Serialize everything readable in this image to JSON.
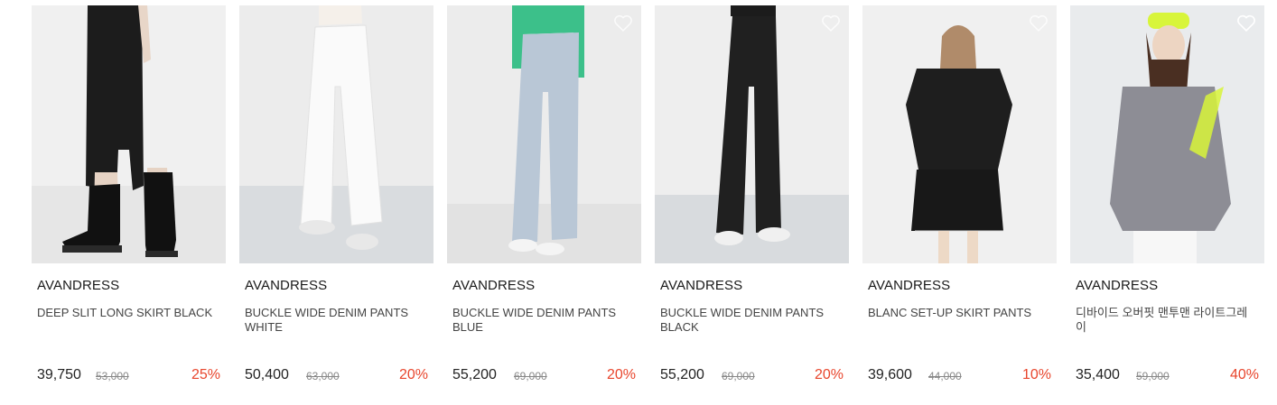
{
  "products": [
    {
      "brand": "AVANDRESS",
      "name": "DEEP SLIT LONG SKIRT BLACK",
      "price": "39,750",
      "original_price": "53,000",
      "discount": "25%"
    },
    {
      "brand": "AVANDRESS",
      "name": "BUCKLE WIDE DENIM PANTS WHITE",
      "price": "50,400",
      "original_price": "63,000",
      "discount": "20%"
    },
    {
      "brand": "AVANDRESS",
      "name": "BUCKLE WIDE DENIM PANTS BLUE",
      "price": "55,200",
      "original_price": "69,000",
      "discount": "20%"
    },
    {
      "brand": "AVANDRESS",
      "name": "BUCKLE WIDE DENIM PANTS BLACK",
      "price": "55,200",
      "original_price": "69,000",
      "discount": "20%"
    },
    {
      "brand": "AVANDRESS",
      "name": "BLANC SET-UP SKIRT PANTS",
      "price": "39,600",
      "original_price": "44,000",
      "discount": "10%"
    },
    {
      "brand": "AVANDRESS",
      "name": "디바이드 오버핏 맨투맨 라이트그레이",
      "price": "35,400",
      "original_price": "59,000",
      "discount": "40%"
    }
  ],
  "icons": {
    "wishlist": "heart-outline-icon"
  },
  "colors": {
    "discount": "#e8452c",
    "photo_background": "#efefef"
  }
}
